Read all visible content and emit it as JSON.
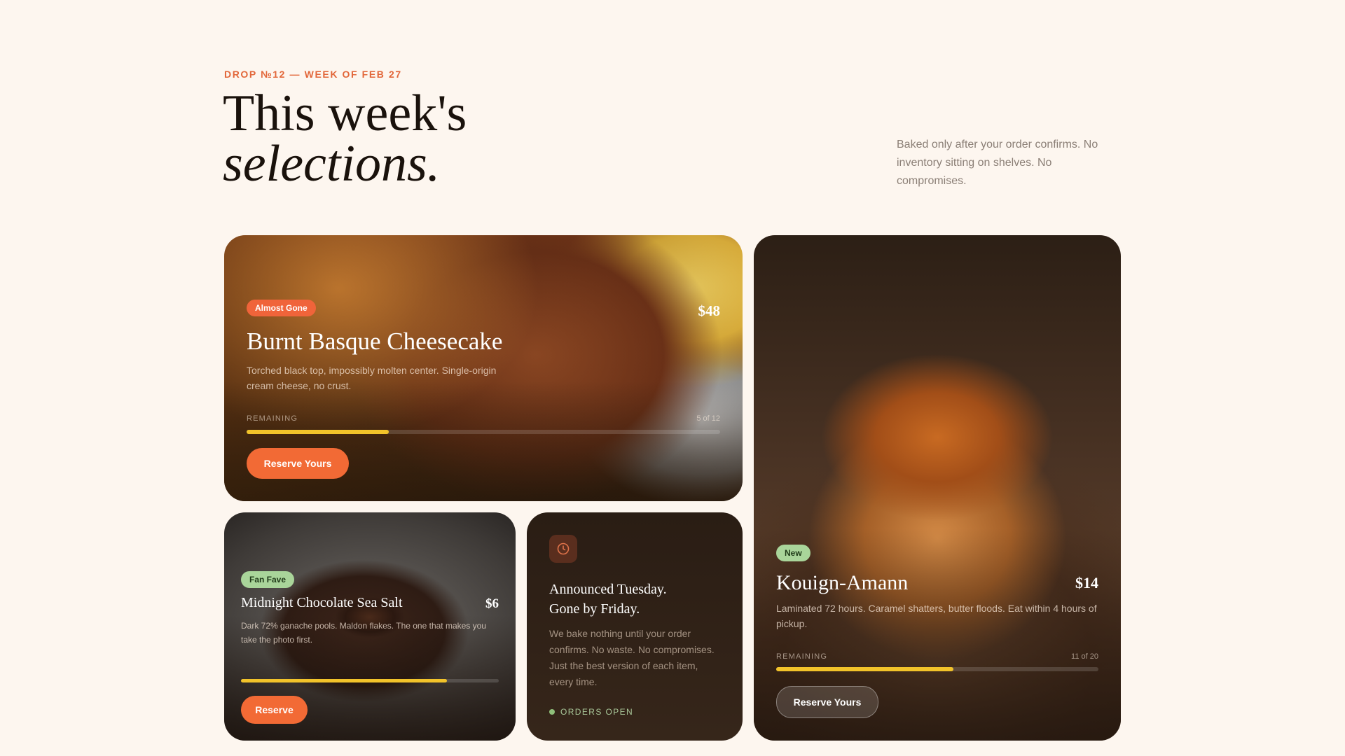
{
  "header": {
    "eyebrow": "DROP №12 — WEEK OF FEB 27",
    "title_line1": "This week's",
    "title_line2": "selections.",
    "intro": "Baked only after your order confirms. No inventory sitting on shelves. No compromises."
  },
  "products": {
    "cheesecake": {
      "badge": "Almost Gone",
      "name": "Burnt Basque Cheesecake",
      "price": "$48",
      "description": "Torched black top, impossibly molten center. Single-origin cream cheese, no crust.",
      "remaining_label": "REMAINING",
      "remaining_text": "5 of 12",
      "remaining_fraction": 0.3,
      "cta": "Reserve Yours"
    },
    "kouign": {
      "badge": "New",
      "name": "Kouign-Amann",
      "price": "$14",
      "description": "Laminated 72 hours. Caramel shatters, butter floods. Eat within 4 hours of pickup.",
      "remaining_label": "REMAINING",
      "remaining_text": "11 of 20",
      "remaining_fraction": 0.55,
      "cta": "Reserve Yours"
    },
    "chocolate": {
      "badge": "Fan Fave",
      "name": "Midnight Chocolate Sea Salt",
      "price": "$6",
      "description": "Dark 72% ganache pools. Maldon flakes. The one that makes you take the photo first.",
      "remaining_fraction": 0.8,
      "cta": "Reserve"
    }
  },
  "info": {
    "icon": "clock-icon",
    "title_line1": "Announced Tuesday.",
    "title_line2": "Gone by Friday.",
    "body": "We bake nothing until your order confirms. No waste. No compromises. Just the best version of each item, every time.",
    "status": "ORDERS OPEN"
  },
  "colors": {
    "accent": "#f26a35",
    "progress": "#f2c32a",
    "badge_green": "#a9d59a"
  }
}
